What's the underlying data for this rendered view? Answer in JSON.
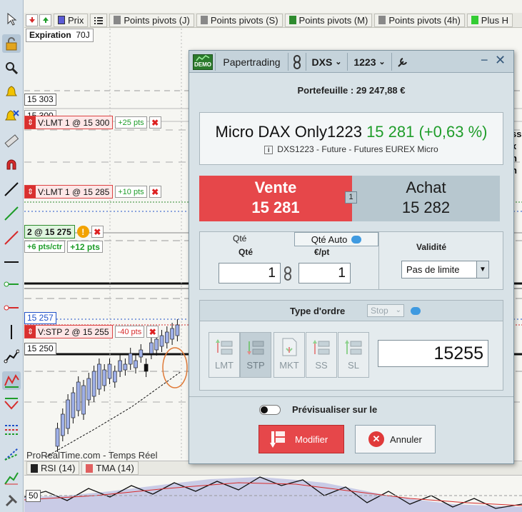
{
  "topbar": {
    "tabs": [
      {
        "label": "Prix",
        "color": "#5b5bd6"
      },
      {
        "label": "Points pivots (J)",
        "color": "#888888"
      },
      {
        "label": "Points pivots (S)",
        "color": "#888888"
      },
      {
        "label": "Points pivots (M)",
        "color": "#2e8b2e"
      },
      {
        "label": "Points pivots (4h)",
        "color": "#888888"
      },
      {
        "label": "Plus H",
        "color": "#33cc33"
      }
    ]
  },
  "chart": {
    "expiration_label": "Expiration",
    "expiration_value": "70J",
    "price_15303": "15 303",
    "price_15300": "15 300",
    "price_15257": "15 257",
    "price_15250": "15 250",
    "watermark": "ProRealTime.com - Temps Réel",
    "orders": {
      "o1": {
        "label": "V:LMT 1 @ 15 300",
        "pts": "+25 pts"
      },
      "o2": {
        "label": "V:LMT 1 @ 15 285",
        "pts": "+10 pts"
      },
      "pos": {
        "label": "2 @ 15 275",
        "pts_ctr": "+6 pts/ctr",
        "pts": "+12 pts"
      },
      "o3": {
        "label": "V:STP 2 @ 15 255",
        "pts": "-40 pts"
      }
    },
    "right_edge": [
      "ss",
      "x",
      "n",
      "n"
    ]
  },
  "rsi": {
    "tab1": "RSI (14)",
    "tab2": "TMA (14)",
    "level": "50"
  },
  "dialog": {
    "demo_badge": "DEMO",
    "mode": "Papertrading",
    "instrument": "DXS",
    "expiry": "1223",
    "portfolio": "Portefeuille : 29 247,88 €",
    "quote": {
      "name": "Micro DAX Only1223",
      "price": "15 281",
      "change": "(+0,63 %)",
      "info": "DXS1223 - Future - Futures EUREX Micro"
    },
    "sell": {
      "label": "Vente",
      "price": "15 281"
    },
    "buy": {
      "label": "Achat",
      "price": "15 282"
    },
    "spread": "1",
    "qty": {
      "qte_label": "Qté",
      "qte_header": "Qté",
      "qte_auto": "Qté Auto",
      "per_pt_label": "€/pt",
      "qte_value": "1",
      "per_pt_value": "1",
      "validite_label": "Validité",
      "validite_value": "Pas de limite"
    },
    "order_type": {
      "label": "Type d'ordre",
      "selected": "Stop",
      "buttons": [
        "LMT",
        "STP",
        "MKT",
        "SS",
        "SL"
      ],
      "stop_price": "15255"
    },
    "preview_label": "Prévisualiser sur le",
    "modify_label": "Modifier",
    "cancel_label": "Annuler"
  }
}
